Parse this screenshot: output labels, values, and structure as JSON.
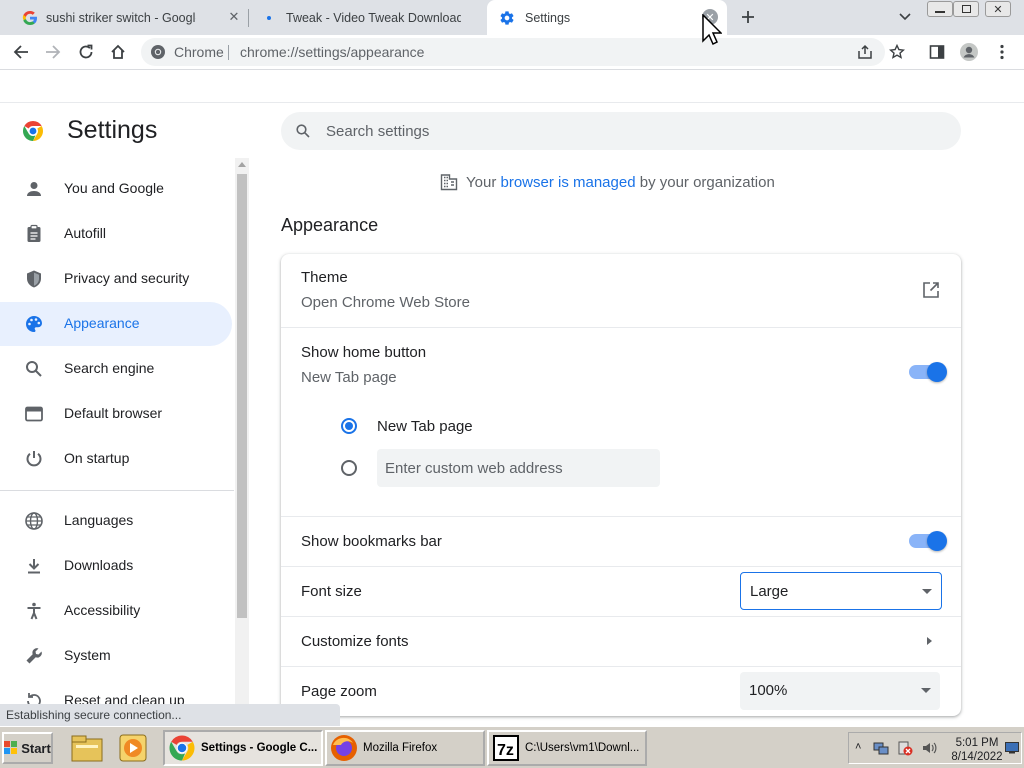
{
  "tabs": [
    {
      "title": "sushi striker switch - Google Search",
      "icon": "google-g-icon"
    },
    {
      "title": "Tweak - Video Tweak Downloads",
      "icon": "page-icon"
    },
    {
      "title": "Settings",
      "icon": "settings-gear-icon",
      "active": true
    }
  ],
  "toolbar": {
    "site_label": "Chrome",
    "url": "chrome://settings/appearance"
  },
  "settings": {
    "title": "Settings",
    "search_placeholder": "Search settings",
    "managed": {
      "prefix": "Your ",
      "link": "browser is managed",
      "suffix": " by your organization"
    },
    "nav": [
      {
        "label": "You and Google",
        "icon": "person-icon"
      },
      {
        "label": "Autofill",
        "icon": "clipboard-icon"
      },
      {
        "label": "Privacy and security",
        "icon": "shield-icon"
      },
      {
        "label": "Appearance",
        "icon": "palette-icon",
        "active": true
      },
      {
        "label": "Search engine",
        "icon": "search-icon"
      },
      {
        "label": "Default browser",
        "icon": "browser-window-icon"
      },
      {
        "label": "On startup",
        "icon": "power-icon"
      },
      {
        "label": "Languages",
        "icon": "globe-icon"
      },
      {
        "label": "Downloads",
        "icon": "download-icon"
      },
      {
        "label": "Accessibility",
        "icon": "accessibility-icon"
      },
      {
        "label": "System",
        "icon": "wrench-icon"
      },
      {
        "label": "Reset and clean up",
        "icon": "reset-icon"
      }
    ],
    "section_title": "Appearance",
    "theme": {
      "label": "Theme",
      "sub": "Open Chrome Web Store"
    },
    "home_button": {
      "label": "Show home button",
      "sub": "New Tab page",
      "enabled": true
    },
    "home_options": {
      "new_tab": "New Tab page",
      "custom_placeholder": "Enter custom web address",
      "selected": "new_tab"
    },
    "bookmarks_bar": {
      "label": "Show bookmarks bar",
      "enabled": true
    },
    "font_size": {
      "label": "Font size",
      "value": "Large"
    },
    "customize_fonts": {
      "label": "Customize fonts"
    },
    "page_zoom": {
      "label": "Page zoom",
      "value": "100%"
    }
  },
  "status_bar": "Establishing secure connection...",
  "taskbar": {
    "start_label": "Start",
    "tasks": [
      {
        "label": "Settings - Google C...",
        "active": true
      },
      {
        "label": "Mozilla Firefox"
      },
      {
        "label": "C:\\Users\\vm1\\Downl..."
      }
    ],
    "clock_time": "5:01 PM",
    "clock_date": "8/14/2022"
  },
  "colors": {
    "accent": "#1a73e8",
    "active_nav_bg": "#e8f0fe",
    "tab_strip": "#dee1e6",
    "taskbar": "#d4d0c8"
  }
}
